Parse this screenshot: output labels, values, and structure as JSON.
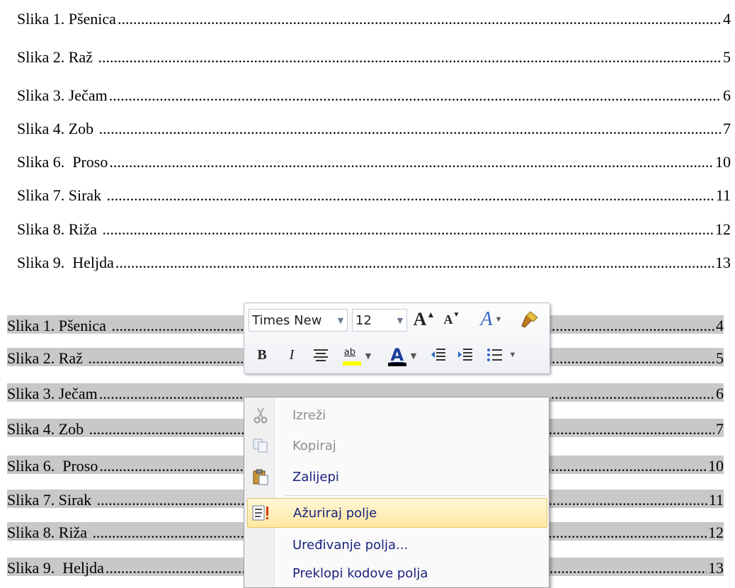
{
  "toc_plain": [
    {
      "title": "Slika 1. Pšenica",
      "page": "4"
    },
    {
      "title": "Slika 2. Raž ",
      "page": "5"
    },
    {
      "title": "Slika 3. Ječam",
      "page": "6"
    },
    {
      "title": "Slika 4. Zob ",
      "page": "7"
    },
    {
      "title": "Slika 6.  Proso",
      "page": "10"
    },
    {
      "title": "Slika 7. Sirak ",
      "page": "11"
    },
    {
      "title": "Slika 8. Riža ",
      "page": "12"
    },
    {
      "title": "Slika 9.  Heljda",
      "page": "13"
    }
  ],
  "toc_selected": [
    {
      "title": "Slika 1. Pšenica ",
      "page": "4"
    },
    {
      "title": "Slika 2. Raž ",
      "page": "5"
    },
    {
      "title": "Slika 3. Ječam",
      "page": "6"
    },
    {
      "title": "Slika 4. Zob ",
      "page": "7"
    },
    {
      "title": "Slika 6.  Proso",
      "page": "10"
    },
    {
      "title": "Slika 7. Sirak ",
      "page": "11"
    },
    {
      "title": "Slika 8. Riža ",
      "page": "12"
    },
    {
      "title": "Slika 9.  Heljda",
      "page": "13"
    }
  ],
  "mini_toolbar": {
    "font_name": "Times New",
    "font_size": "12",
    "grow_font": "A",
    "shrink_font": "A",
    "styles": "A",
    "bold": "B",
    "italic": "I",
    "font_color": "A",
    "highlight": "ab"
  },
  "context_menu": {
    "items": [
      {
        "label": "Izreži",
        "icon": "scissors-icon",
        "disabled": true
      },
      {
        "label": "Kopiraj",
        "icon": "copy-icon",
        "disabled": true
      },
      {
        "label": "Zalijepi",
        "icon": "paste-icon",
        "disabled": false
      },
      {
        "label": "Ažuriraj polje",
        "icon": "update-field-icon",
        "disabled": false,
        "highlighted": true
      },
      {
        "label": "Uređivanje polja...",
        "icon": "",
        "disabled": false
      },
      {
        "label": "Preklopi kodove polja",
        "icon": "",
        "disabled": false
      }
    ]
  },
  "colors": {
    "selection": "#c8c8c8",
    "highlight": "#ffe7a0",
    "menu_text": "#1a237e"
  }
}
